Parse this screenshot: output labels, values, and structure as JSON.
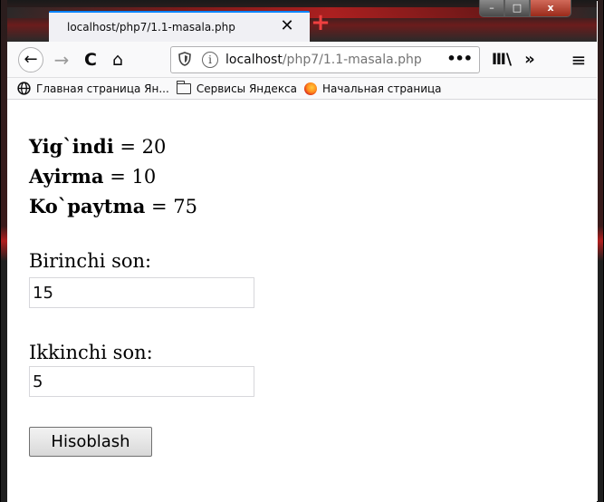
{
  "browser": {
    "tab": {
      "title": "localhost/php7/1.1-masala.php",
      "close": "✕"
    },
    "new_tab": "+",
    "window_controls": {
      "minimize": "–",
      "maximize": "□",
      "close": "x"
    },
    "nav": {
      "back": "←",
      "forward": "→",
      "reload": "C",
      "home": "⌂",
      "url_host": "localhost",
      "url_path": "/php7/1.1-masala.php",
      "page_actions": "•••",
      "library": "Ⅲ\\",
      "overflow": "»",
      "menu": "≡"
    },
    "bookmarks": [
      {
        "label": "Главная страница Ян...",
        "icon": "globe-icon"
      },
      {
        "label": "Сервисы Яндекса",
        "icon": "folder-icon"
      },
      {
        "label": "Начальная страница",
        "icon": "firefox-icon"
      }
    ]
  },
  "page": {
    "results": [
      {
        "name": "Yig`indi",
        "sep": " = ",
        "value": "20"
      },
      {
        "name": "Ayirma",
        "sep": " = ",
        "value": "10"
      },
      {
        "name": "Ko`paytma",
        "sep": " = ",
        "value": "75"
      }
    ],
    "first_label": "Birinchi son:",
    "first_value": "15",
    "second_label": "Ikkinchi son:",
    "second_value": "5",
    "submit_label": "Hisoblash"
  }
}
